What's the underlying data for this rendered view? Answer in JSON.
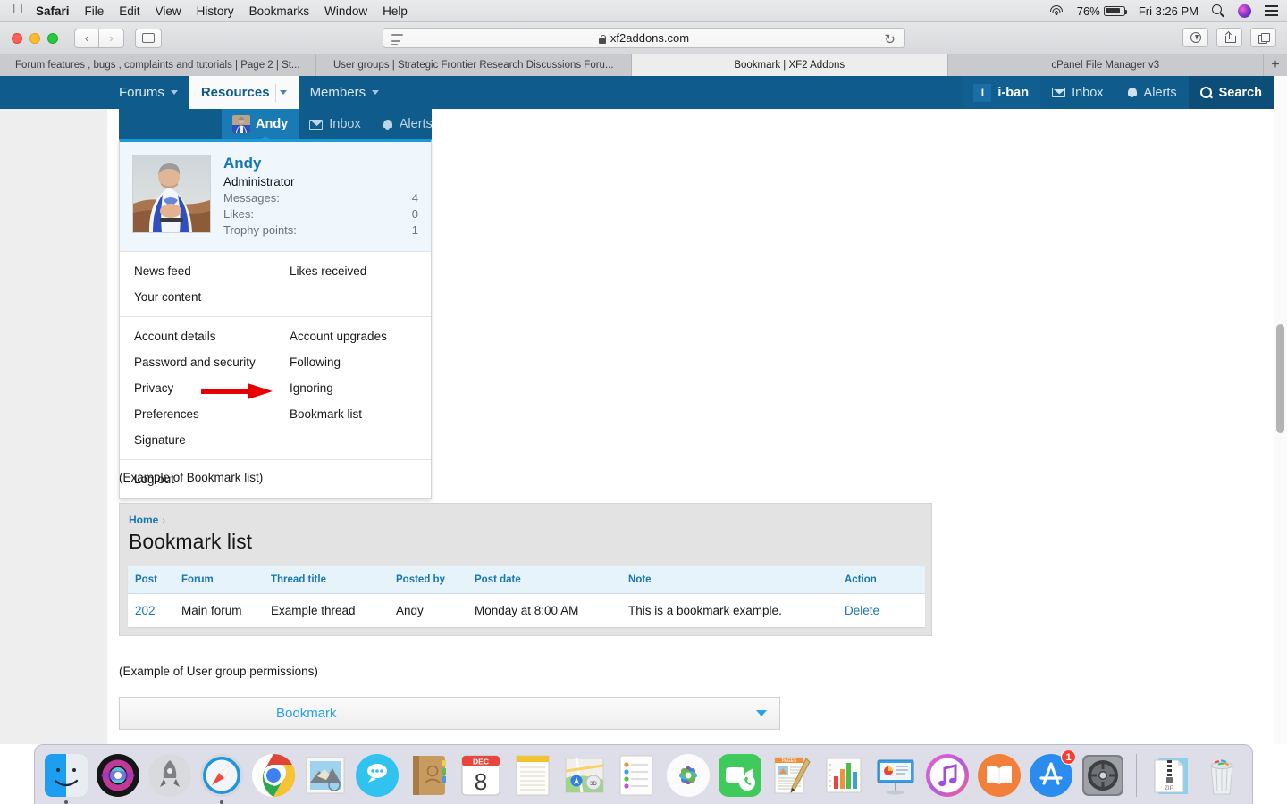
{
  "menubar": {
    "apple": "apple-logo",
    "items": [
      "Safari",
      "File",
      "Edit",
      "View",
      "History",
      "Bookmarks",
      "Window",
      "Help"
    ],
    "battery_percent": "76%",
    "clock": "Fri 3:26 PM"
  },
  "toolbar": {
    "url": "xf2addons.com",
    "back_glyph": "‹",
    "forward_glyph": "›",
    "reload_glyph": "↻"
  },
  "tabs": [
    {
      "label": "Forum features , bugs , complaints and tutorials | Page 2 | St...",
      "active": false
    },
    {
      "label": "User groups | Strategic Frontier Research Discussions Foru...",
      "active": false
    },
    {
      "label": "Bookmark | XF2 Addons",
      "active": true
    },
    {
      "label": "cPanel File Manager v3",
      "active": false
    }
  ],
  "new_tab_glyph": "+",
  "forum_nav": {
    "left": [
      {
        "label": "Forums",
        "active": false,
        "caret": true
      },
      {
        "label": "Resources",
        "active": true,
        "caret": true
      },
      {
        "label": "Members",
        "active": false,
        "caret": true
      }
    ],
    "right": [
      {
        "label": "i-ban",
        "icon": "avatar-initial",
        "initial": "I",
        "style": "user"
      },
      {
        "label": "Inbox",
        "icon": "envelope-icon",
        "style": "plain"
      },
      {
        "label": "Alerts",
        "icon": "bell-icon",
        "style": "plain"
      },
      {
        "label": "Search",
        "icon": "search-icon",
        "style": "search"
      }
    ]
  },
  "account_popup": {
    "tabs": [
      {
        "label": "Andy",
        "icon": "avatar-thumbnail",
        "active": true
      },
      {
        "label": "Inbox",
        "icon": "envelope-icon",
        "active": false
      },
      {
        "label": "Alerts",
        "icon": "bell-icon",
        "active": false
      }
    ],
    "username": "Andy",
    "role": "Administrator",
    "stats": [
      {
        "label": "Messages:",
        "value": "4"
      },
      {
        "label": "Likes:",
        "value": "0"
      },
      {
        "label": "Trophy points:",
        "value": "1"
      }
    ],
    "sections": [
      {
        "rows": [
          {
            "left": "News feed",
            "right": "Likes received"
          },
          {
            "left": "Your content",
            "right": ""
          }
        ]
      },
      {
        "rows": [
          {
            "left": "Account details",
            "right": "Account upgrades"
          },
          {
            "left": "Password and security",
            "right": "Following"
          },
          {
            "left": "Privacy",
            "right": "Ignoring"
          },
          {
            "left": "Preferences",
            "right": "Bookmark list"
          },
          {
            "left": "Signature",
            "right": ""
          }
        ]
      },
      {
        "rows": [
          {
            "left": "Log out",
            "right": ""
          }
        ]
      }
    ],
    "annotation": {
      "type": "red-arrow",
      "points_to": "Bookmark list",
      "color": "#e80000"
    }
  },
  "examples": {
    "bookmark_caption": "(Example of Bookmark list)",
    "permissions_caption": "(Example of User group permissions)"
  },
  "bookmark_list": {
    "breadcrumb": "Home",
    "breadcrumb_chevron": "›",
    "title": "Bookmark list",
    "columns": [
      "Post",
      "Forum",
      "Thread title",
      "Posted by",
      "Post date",
      "Note",
      "Action"
    ],
    "rows": [
      {
        "post": "202",
        "forum": "Main forum",
        "thread_title": "Example thread",
        "posted_by": "Andy",
        "post_date": "Monday at 8:00 AM",
        "note": "This is a bookmark example.",
        "action": "Delete"
      }
    ]
  },
  "permissions": {
    "label": "Bookmark",
    "caret": "▼"
  },
  "dock": {
    "items": [
      {
        "name": "finder",
        "running": true
      },
      {
        "name": "siri",
        "running": false
      },
      {
        "name": "launchpad",
        "running": false
      },
      {
        "name": "safari",
        "running": true
      },
      {
        "name": "chrome",
        "running": false
      },
      {
        "name": "mail",
        "running": false
      },
      {
        "name": "messages",
        "running": false
      },
      {
        "name": "contacts",
        "running": false
      },
      {
        "name": "calendar",
        "running": false,
        "month": "DEC",
        "day": "8"
      },
      {
        "name": "notes",
        "running": false
      },
      {
        "name": "maps",
        "running": false
      },
      {
        "name": "reminders",
        "running": false
      },
      {
        "name": "photos",
        "running": false
      },
      {
        "name": "facetime",
        "running": false
      },
      {
        "name": "pages",
        "running": false
      },
      {
        "name": "numbers",
        "running": false
      },
      {
        "name": "keynote",
        "running": false
      },
      {
        "name": "itunes",
        "running": false
      },
      {
        "name": "ibooks",
        "running": false
      },
      {
        "name": "app-store",
        "running": false,
        "badge": "1"
      },
      {
        "name": "system-preferences",
        "running": false
      }
    ],
    "zip_label": "ZIP"
  },
  "colors": {
    "forum_nav_blue": "#0f5c8c",
    "link_blue": "#1776b6",
    "accent_blue": "#1a9bd7",
    "arrow_red": "#e80000"
  }
}
